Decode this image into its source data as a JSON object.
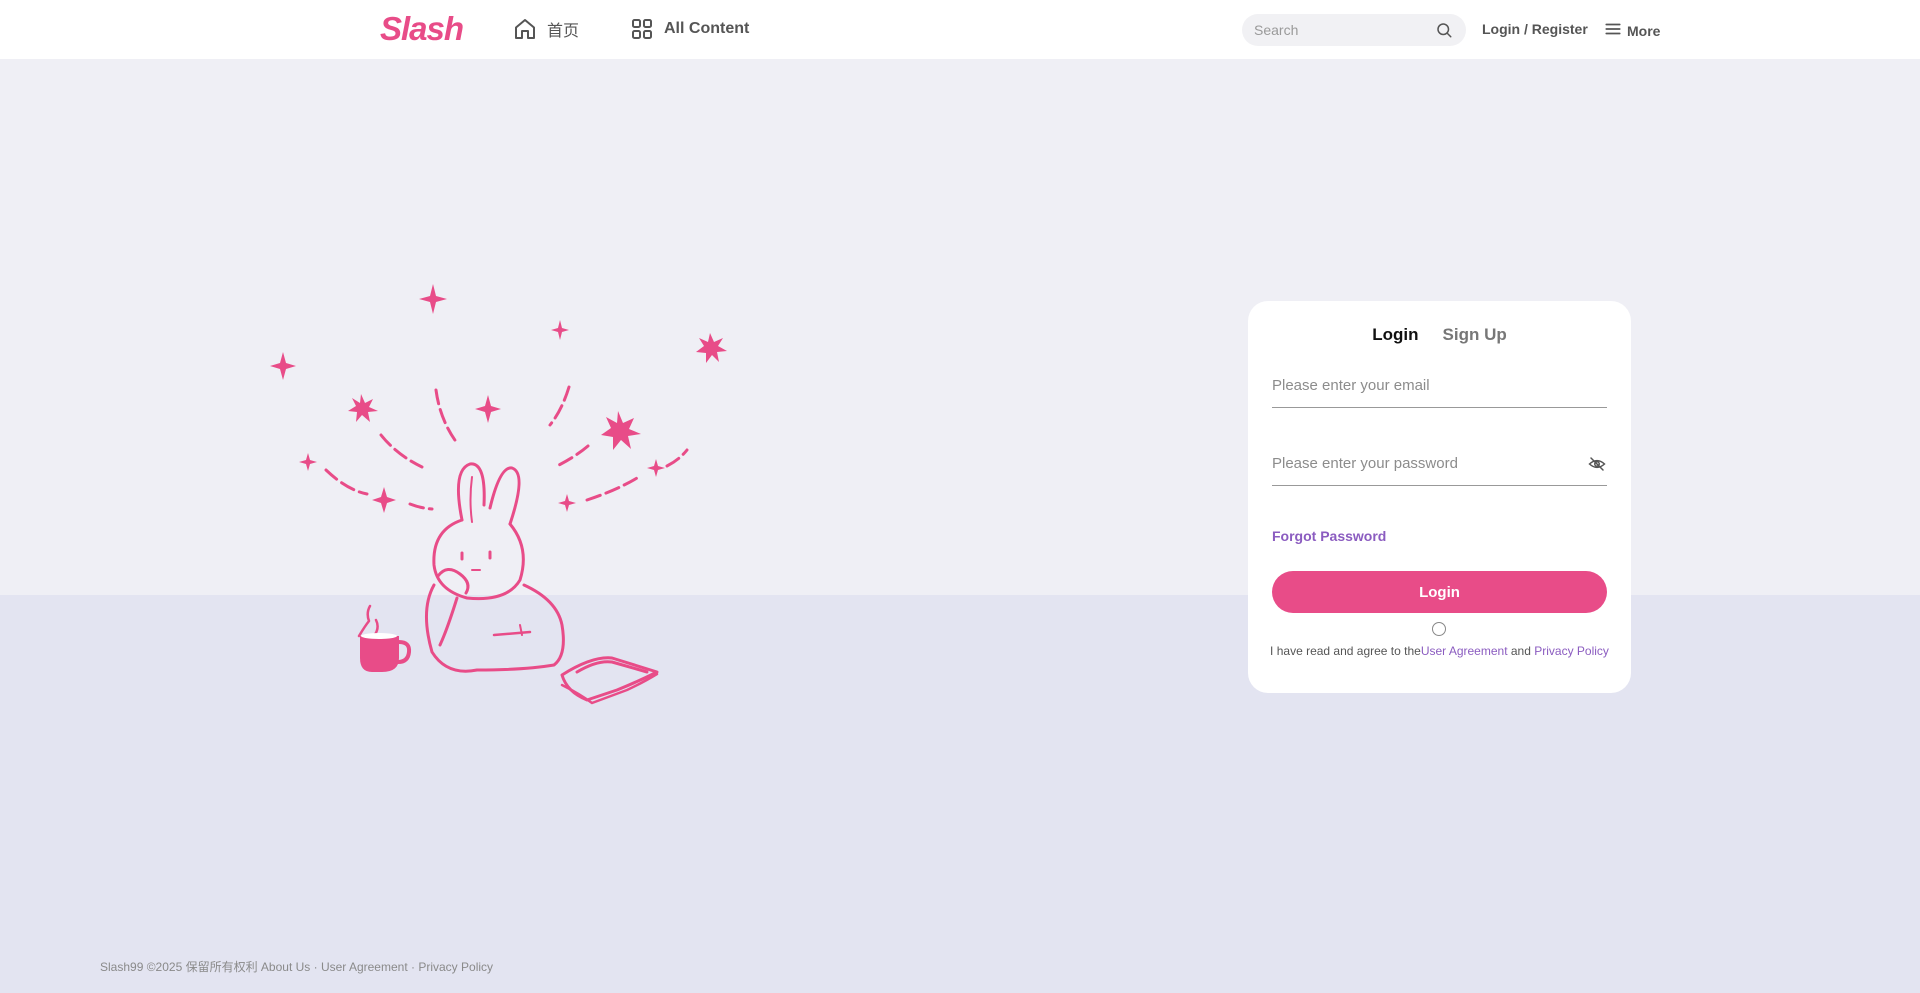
{
  "header": {
    "logo": "Slash",
    "nav": {
      "home_label": "首页",
      "all_content_label": "All Content"
    },
    "search": {
      "placeholder": "Search"
    },
    "login_register": "Login / Register",
    "more_label": "More"
  },
  "login_card": {
    "tabs": [
      {
        "label": "Login",
        "active": true
      },
      {
        "label": "Sign Up",
        "active": false
      }
    ],
    "email_placeholder": "Please enter your email",
    "password_placeholder": "Please enter your password",
    "forgot_password": "Forgot Password",
    "login_button": "Login",
    "agreement": {
      "prefix": "I have read and agree to the",
      "user_agreement": "User Agreement",
      "and": " and ",
      "privacy_policy": "Privacy Policy"
    }
  },
  "footer": {
    "copyright": "Slash99 ©2025 保留所有权利",
    "about": "About Us",
    "sep": " · ",
    "user_agreement": "User Agreement",
    "privacy_policy": "Privacy Policy"
  },
  "colors": {
    "brand": "#e84c88",
    "link": "#8b5cc0",
    "background_top": "#efeff5",
    "background_bottom": "#e3e4f1"
  },
  "icons": [
    "home-icon",
    "grid-icon",
    "search-icon",
    "menu-icon",
    "eye-off-icon"
  ]
}
